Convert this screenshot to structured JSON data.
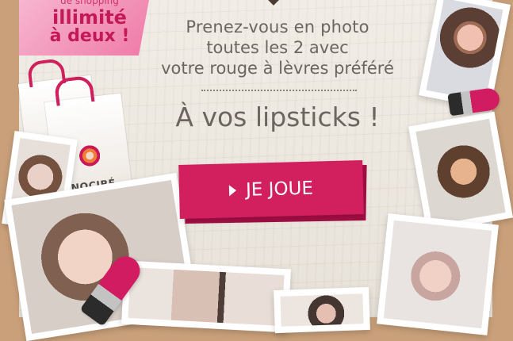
{
  "promo": {
    "line1": "de shopping",
    "line2": "illimité",
    "line3": "à deux !"
  },
  "brand": {
    "bag_label": "NOCIBÉ"
  },
  "headline": {
    "line1": "Prenez-vous en photo",
    "line2": "toutes les 2 avec",
    "line3": "votre rouge à lèvres préféré"
  },
  "slogan": "À vos lipsticks !",
  "cta": {
    "label": "JE JOUE",
    "icon": "play-icon"
  },
  "colors": {
    "frame": "#c9a07a",
    "accent": "#d2205e",
    "text": "#6d6560"
  }
}
